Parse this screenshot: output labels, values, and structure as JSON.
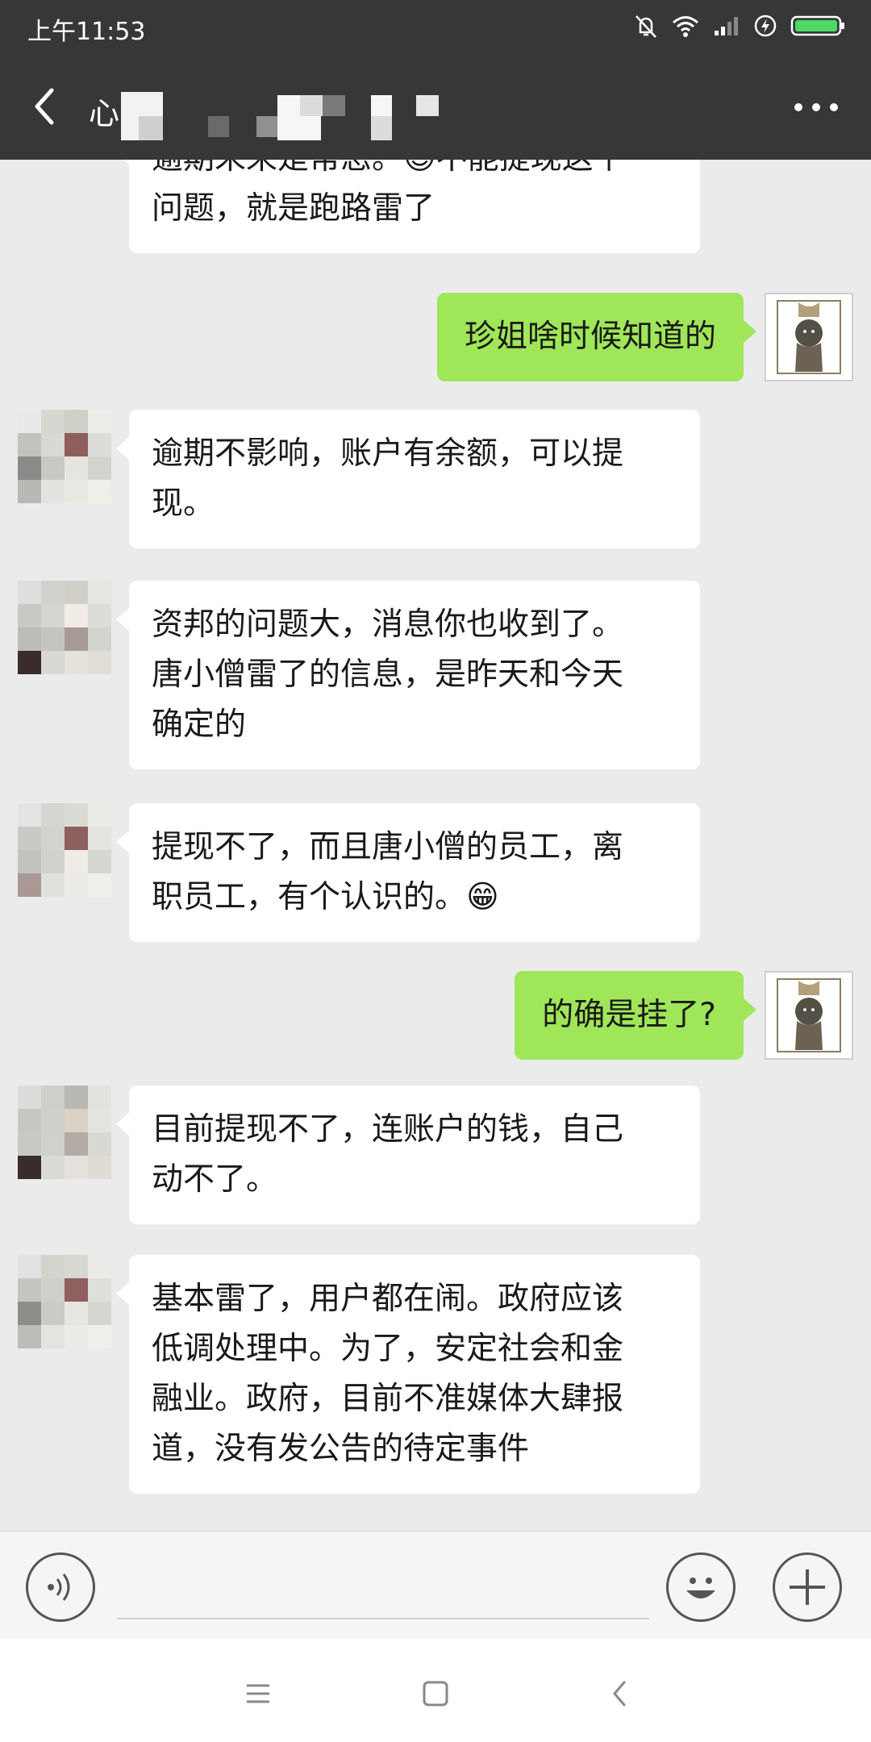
{
  "status_bar": {
    "time": "上午11:53",
    "icons": [
      "mute-bell-icon",
      "wifi-icon",
      "signal-icon",
      "charging-icon",
      "battery-icon"
    ],
    "battery_color": "#4cd964"
  },
  "header": {
    "contact_name": "心",
    "back_icon": "chevron-left-icon",
    "more_icon": "more-dots-icon"
  },
  "messages": [
    {
      "from": "other",
      "text_lines": [
        "逾期未来是常态。😊不能提现这个",
        "问题，就是跑路雷了"
      ]
    },
    {
      "from": "me",
      "text": "珍姐啥时候知道的"
    },
    {
      "from": "other",
      "text_lines": [
        "逾期不影响，账户有余额，可以提",
        "现。"
      ]
    },
    {
      "from": "other",
      "text_lines": [
        "资邦的问题大，消息你也收到了。",
        "唐小僧雷了的信息，是昨天和今天",
        "确定的"
      ]
    },
    {
      "from": "other",
      "text_lines": [
        "提现不了，而且唐小僧的员工，离",
        "职员工，有个认识的。😁"
      ]
    },
    {
      "from": "me",
      "text": "的确是挂了?"
    },
    {
      "from": "other",
      "text_lines": [
        "目前提现不了，连账户的钱，自己",
        "动不了。"
      ]
    },
    {
      "from": "other",
      "text_lines": [
        "基本雷了，用户都在闹。政府应该",
        "低调处理中。为了，安定社会和金",
        "融业。政府，目前不准媒体大肆报",
        "道，没有发公告的待定事件"
      ]
    }
  ],
  "input_bar": {
    "voice_icon": "voice-icon",
    "emoji_icon": "emoji-icon",
    "plus_icon": "plus-icon"
  },
  "nav_bar": {
    "icons": [
      "menu-icon",
      "home-square-icon",
      "back-arrow-icon"
    ]
  },
  "colors": {
    "header_bg": "#373737",
    "chat_bg": "#ebebeb",
    "outgoing_bubble": "#9fe658",
    "incoming_bubble": "#ffffff"
  }
}
